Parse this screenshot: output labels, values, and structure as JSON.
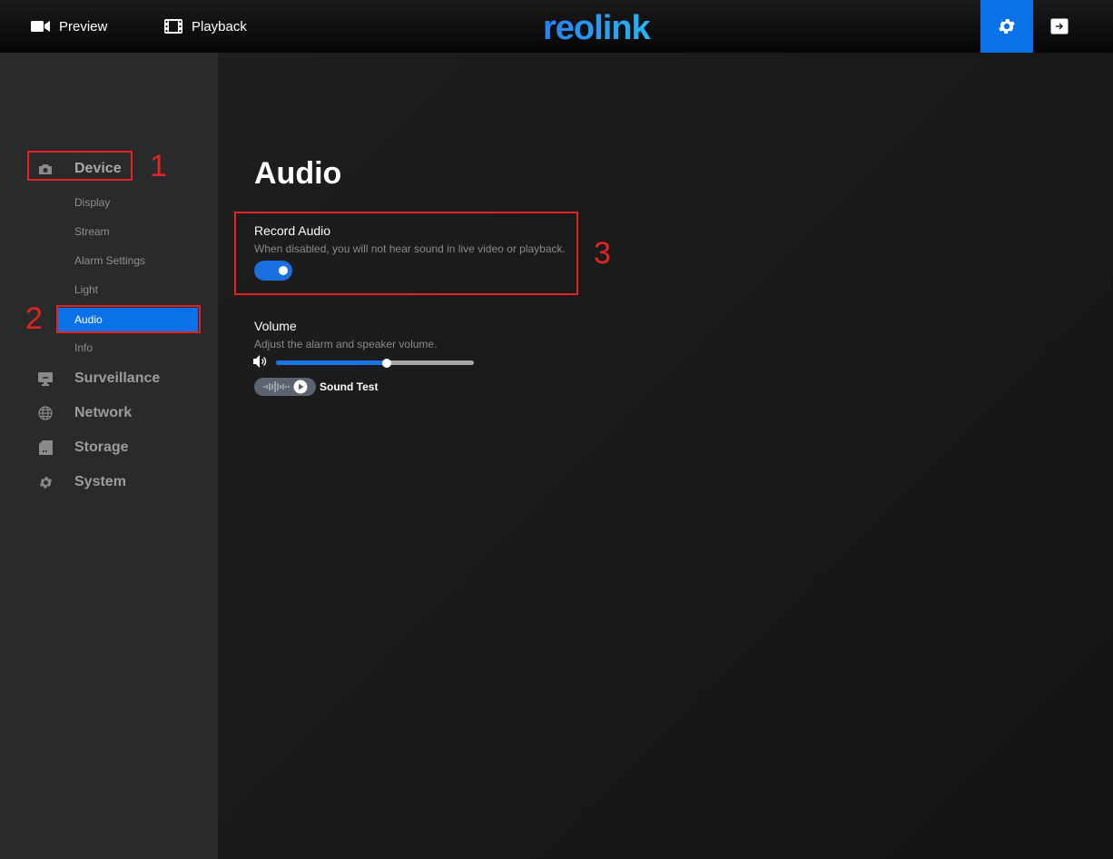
{
  "topbar": {
    "preview_label": "Preview",
    "playback_label": "Playback",
    "logo_text": "reolink"
  },
  "sidebar": {
    "sections": [
      {
        "label": "Device",
        "icon": "camera-icon"
      },
      {
        "label": "Surveillance",
        "icon": "monitor-icon"
      },
      {
        "label": "Network",
        "icon": "globe-icon"
      },
      {
        "label": "Storage",
        "icon": "sd-card-icon"
      },
      {
        "label": "System",
        "icon": "gear-icon"
      }
    ],
    "device_items": [
      "Display",
      "Stream",
      "Alarm Settings",
      "Light",
      "Audio",
      "Info"
    ],
    "active_item": "Audio"
  },
  "main": {
    "title": "Audio",
    "record_audio": {
      "title": "Record Audio",
      "description": "When disabled, you will not hear sound in live video or playback.",
      "enabled": true
    },
    "volume": {
      "title": "Volume",
      "description": "Adjust the alarm and speaker volume.",
      "level_fraction": 0.56
    },
    "sound_test_label": "Sound Test"
  },
  "annotations": [
    "1",
    "2",
    "3"
  ],
  "colors": {
    "accent": "#0a72e8",
    "annotation": "#e02424",
    "sidebar_bg": "#2a2a2a",
    "main_bg": "#1a1a1a"
  }
}
